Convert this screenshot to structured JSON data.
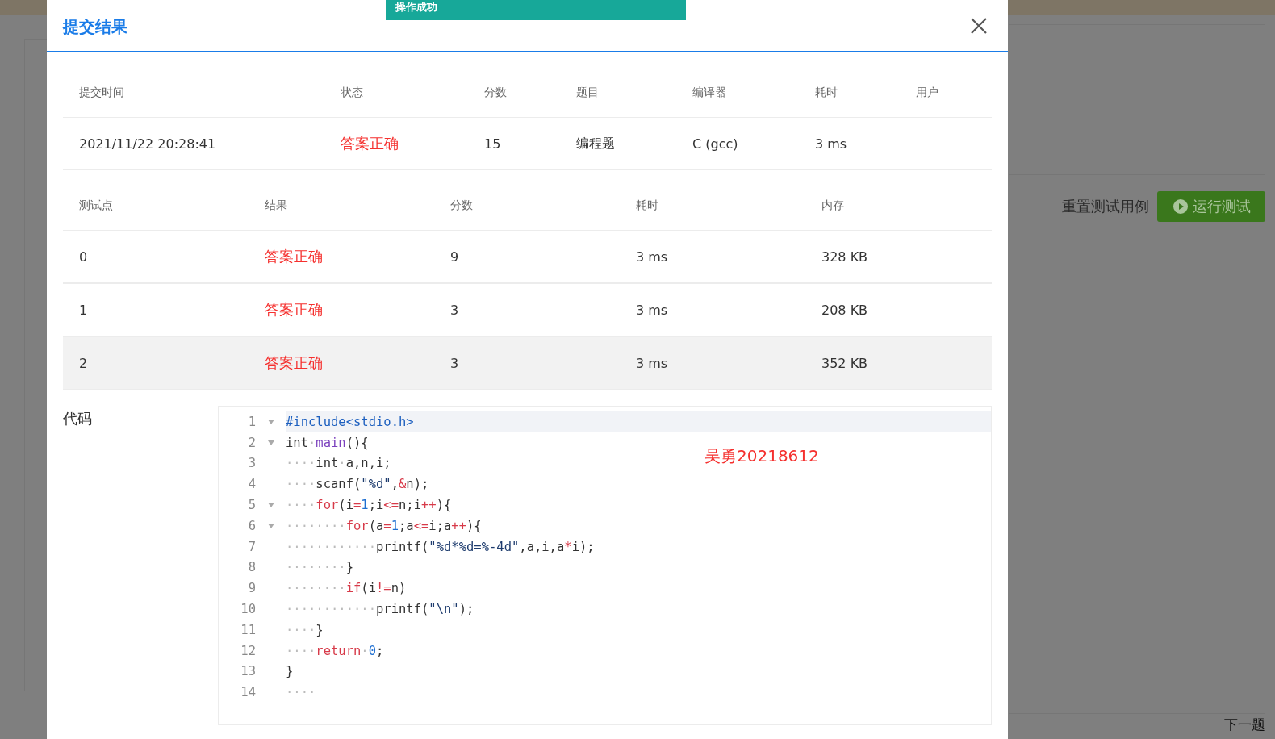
{
  "background": {
    "reset_label": "重置测试用例",
    "run_button": "运行测试",
    "next_link": "下一题"
  },
  "toast": {
    "text": "操作成功"
  },
  "dialog": {
    "title": "提交结果",
    "summary": {
      "columns": [
        "提交时间",
        "状态",
        "分数",
        "题目",
        "编译器",
        "耗时",
        "用户"
      ],
      "row": [
        {
          "text": "2021/11/22 20:28:41",
          "kind": "plain"
        },
        {
          "text": "答案正确",
          "kind": "verdict"
        },
        {
          "text": "15",
          "kind": "plain"
        },
        {
          "text": "编程题",
          "kind": "plain"
        },
        {
          "text": "C (gcc)",
          "kind": "plain"
        },
        {
          "text": "3 ms",
          "kind": "plain"
        }
      ]
    },
    "tests": {
      "columns": [
        "测试点",
        "结果",
        "分数",
        "耗时",
        "内存"
      ],
      "rows": [
        {
          "highlighted": false,
          "cells": [
            {
              "text": "0",
              "kind": "plain"
            },
            {
              "text": "答案正确",
              "kind": "verdict"
            },
            {
              "text": "9",
              "kind": "plain"
            },
            {
              "text": "3 ms",
              "kind": "plain"
            },
            {
              "text": "328 KB",
              "kind": "plain"
            }
          ]
        },
        {
          "highlighted": false,
          "cells": [
            {
              "text": "1",
              "kind": "plain"
            },
            {
              "text": "答案正确",
              "kind": "verdict"
            },
            {
              "text": "3",
              "kind": "plain"
            },
            {
              "text": "3 ms",
              "kind": "plain"
            },
            {
              "text": "208 KB",
              "kind": "plain"
            }
          ]
        },
        {
          "highlighted": true,
          "cells": [
            {
              "text": "2",
              "kind": "plain"
            },
            {
              "text": "答案正确",
              "kind": "verdict"
            },
            {
              "text": "3",
              "kind": "plain"
            },
            {
              "text": "3 ms",
              "kind": "plain"
            },
            {
              "text": "352 KB",
              "kind": "plain"
            }
          ]
        }
      ]
    },
    "code_label": "代码",
    "code_note": "吴勇20218612",
    "code": [
      {
        "number": "1",
        "foldable": true,
        "active": true,
        "tokens": [
          {
            "kind": "meta",
            "text": "#include<stdio.h>"
          }
        ]
      },
      {
        "number": "2",
        "foldable": true,
        "active": false,
        "tokens": [
          {
            "kind": "plain",
            "text": "int"
          },
          {
            "kind": "space",
            "text": "·"
          },
          {
            "kind": "func",
            "text": "main"
          },
          {
            "kind": "plain",
            "text": "(){"
          }
        ]
      },
      {
        "number": "3",
        "foldable": false,
        "active": false,
        "tokens": [
          {
            "kind": "space",
            "text": "····"
          },
          {
            "kind": "plain",
            "text": "int"
          },
          {
            "kind": "space",
            "text": "·"
          },
          {
            "kind": "plain",
            "text": "a,n,i;"
          }
        ]
      },
      {
        "number": "4",
        "foldable": false,
        "active": false,
        "tokens": [
          {
            "kind": "space",
            "text": "····"
          },
          {
            "kind": "plain",
            "text": "scanf("
          },
          {
            "kind": "str",
            "text": "\"%d\""
          },
          {
            "kind": "plain",
            "text": ","
          },
          {
            "kind": "op",
            "text": "&"
          },
          {
            "kind": "plain",
            "text": "n);"
          }
        ]
      },
      {
        "number": "5",
        "foldable": true,
        "active": false,
        "tokens": [
          {
            "kind": "space",
            "text": "····"
          },
          {
            "kind": "kw",
            "text": "for"
          },
          {
            "kind": "plain",
            "text": "(i"
          },
          {
            "kind": "op",
            "text": "="
          },
          {
            "kind": "num",
            "text": "1"
          },
          {
            "kind": "plain",
            "text": ";i"
          },
          {
            "kind": "op",
            "text": "<="
          },
          {
            "kind": "plain",
            "text": "n;i"
          },
          {
            "kind": "op",
            "text": "++"
          },
          {
            "kind": "plain",
            "text": "){"
          }
        ]
      },
      {
        "number": "6",
        "foldable": true,
        "active": false,
        "tokens": [
          {
            "kind": "space",
            "text": "········"
          },
          {
            "kind": "kw",
            "text": "for"
          },
          {
            "kind": "plain",
            "text": "(a"
          },
          {
            "kind": "op",
            "text": "="
          },
          {
            "kind": "num",
            "text": "1"
          },
          {
            "kind": "plain",
            "text": ";a"
          },
          {
            "kind": "op",
            "text": "<="
          },
          {
            "kind": "plain",
            "text": "i;a"
          },
          {
            "kind": "op",
            "text": "++"
          },
          {
            "kind": "plain",
            "text": "){"
          }
        ]
      },
      {
        "number": "7",
        "foldable": false,
        "active": false,
        "tokens": [
          {
            "kind": "space",
            "text": "············"
          },
          {
            "kind": "plain",
            "text": "printf("
          },
          {
            "kind": "str",
            "text": "\"%d*%d=%-4d\""
          },
          {
            "kind": "plain",
            "text": ",a,i,a"
          },
          {
            "kind": "op",
            "text": "*"
          },
          {
            "kind": "plain",
            "text": "i);"
          }
        ]
      },
      {
        "number": "8",
        "foldable": false,
        "active": false,
        "tokens": [
          {
            "kind": "space",
            "text": "········"
          },
          {
            "kind": "plain",
            "text": "}"
          }
        ]
      },
      {
        "number": "9",
        "foldable": false,
        "active": false,
        "tokens": [
          {
            "kind": "space",
            "text": "········"
          },
          {
            "kind": "kw",
            "text": "if"
          },
          {
            "kind": "plain",
            "text": "(i"
          },
          {
            "kind": "op",
            "text": "!="
          },
          {
            "kind": "plain",
            "text": "n)"
          }
        ]
      },
      {
        "number": "10",
        "foldable": false,
        "active": false,
        "tokens": [
          {
            "kind": "space",
            "text": "············"
          },
          {
            "kind": "plain",
            "text": "printf("
          },
          {
            "kind": "str",
            "text": "\"\\n\""
          },
          {
            "kind": "plain",
            "text": ");"
          }
        ]
      },
      {
        "number": "11",
        "foldable": false,
        "active": false,
        "tokens": [
          {
            "kind": "space",
            "text": "····"
          },
          {
            "kind": "plain",
            "text": "}"
          }
        ]
      },
      {
        "number": "12",
        "foldable": false,
        "active": false,
        "tokens": [
          {
            "kind": "space",
            "text": "····"
          },
          {
            "kind": "kw",
            "text": "return"
          },
          {
            "kind": "space",
            "text": "·"
          },
          {
            "kind": "num",
            "text": "0"
          },
          {
            "kind": "plain",
            "text": ";"
          }
        ]
      },
      {
        "number": "13",
        "foldable": false,
        "active": false,
        "tokens": [
          {
            "kind": "plain",
            "text": "}"
          }
        ]
      },
      {
        "number": "14",
        "foldable": false,
        "active": false,
        "tokens": [
          {
            "kind": "space",
            "text": "····"
          }
        ]
      }
    ]
  }
}
